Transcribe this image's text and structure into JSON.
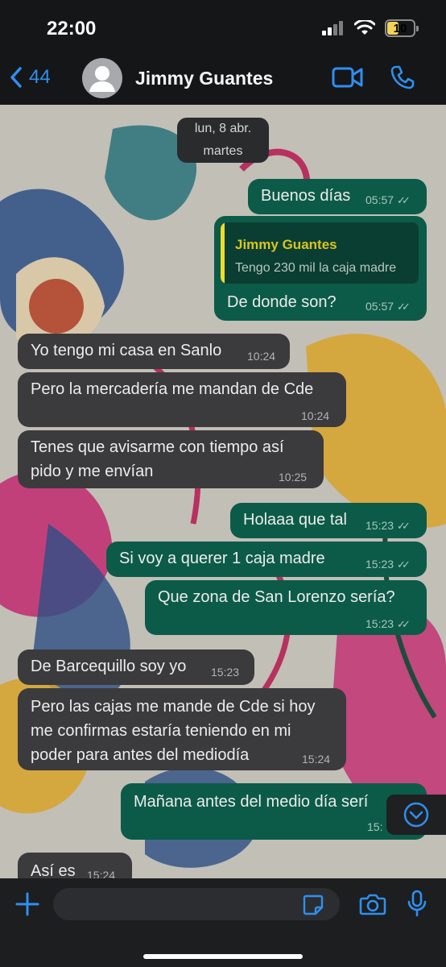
{
  "status_bar": {
    "time": "22:00",
    "battery": "10"
  },
  "header": {
    "back_count": "44",
    "contact_name": "Jimmy Guantes"
  },
  "date_pill": {
    "line1": "lun, 8 abr.",
    "line2": "martes"
  },
  "messages": [
    {
      "dir": "out",
      "text": "Buenos días",
      "time": "05:57"
    },
    {
      "dir": "out",
      "quote_name": "Jimmy Guantes",
      "quote_text": "Tengo 230 mil la caja madre",
      "text": "De donde son?",
      "time": "05:57"
    },
    {
      "dir": "in",
      "text": "Yo tengo mi casa en Sanlo",
      "time": "10:24"
    },
    {
      "dir": "in",
      "text": "Pero la mercadería me mandan de Cde",
      "time": "10:24"
    },
    {
      "dir": "in",
      "lines": [
        "Tenes que avisarme con tiempo así",
        "pido y me envían"
      ],
      "time": "10:25"
    },
    {
      "dir": "out",
      "text": "Holaaa que tal",
      "time": "15:23"
    },
    {
      "dir": "out",
      "text": "Si voy a querer 1 caja madre",
      "time": "15:23"
    },
    {
      "dir": "out",
      "text": "Que zona de San Lorenzo sería?",
      "time": "15:23"
    },
    {
      "dir": "in",
      "text": "De Barcequillo soy yo",
      "time": "15:23"
    },
    {
      "dir": "in",
      "lines": [
        "Pero las cajas me mande de Cde si hoy",
        "me confirmas estaría teniendo en mi",
        "poder para antes del mediodía"
      ],
      "time": "15:24"
    },
    {
      "dir": "out",
      "text": "Mañana antes del medio día serí",
      "time": "15:"
    },
    {
      "dir": "in",
      "text": "Así es",
      "time": "15:24"
    }
  ],
  "input": {
    "placeholder": ""
  },
  "colors": {
    "accent": "#2f8ff0",
    "outgoing": "#0c5b48",
    "incoming": "#3b3b3d",
    "quote_bar": "#f0dc2a"
  }
}
